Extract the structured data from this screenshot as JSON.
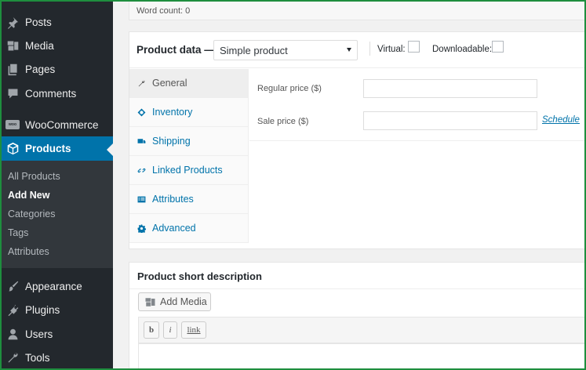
{
  "sidebar": {
    "menu": [
      {
        "label": "Posts",
        "icon": "pushpin-icon"
      },
      {
        "label": "Media",
        "icon": "media-icon"
      },
      {
        "label": "Pages",
        "icon": "pages-icon"
      },
      {
        "label": "Comments",
        "icon": "comment-icon"
      },
      {
        "label": "WooCommerce",
        "icon": "woocommerce-icon"
      },
      {
        "label": "Products",
        "icon": "products-cube-icon"
      },
      {
        "label": "Appearance",
        "icon": "paint-brush-icon"
      },
      {
        "label": "Plugins",
        "icon": "plugin-icon"
      },
      {
        "label": "Users",
        "icon": "user-icon"
      },
      {
        "label": "Tools",
        "icon": "wrench-icon"
      }
    ],
    "woo_badge": "woo",
    "submenu": [
      "All Products",
      "Add New",
      "Categories",
      "Tags",
      "Attributes"
    ],
    "active_submenu": "Add New",
    "accent_color": "#0073aa"
  },
  "editor": {
    "word_count": "Word count: 0"
  },
  "product_data": {
    "title": "Product data —",
    "type_selected": "Simple product",
    "virtual_label": "Virtual:",
    "virtual_checked": false,
    "downloadable_label": "Downloadable:",
    "downloadable_checked": false,
    "tabs": [
      {
        "label": "General",
        "icon": "wrench-icon",
        "active": true
      },
      {
        "label": "Inventory",
        "icon": "tag-icon",
        "active": false
      },
      {
        "label": "Shipping",
        "icon": "truck-icon",
        "active": false
      },
      {
        "label": "Linked Products",
        "icon": "link-icon",
        "active": false
      },
      {
        "label": "Attributes",
        "icon": "list-icon",
        "active": false
      },
      {
        "label": "Advanced",
        "icon": "gear-icon",
        "active": false
      }
    ],
    "regular_price_label": "Regular price ($)",
    "regular_price_value": "",
    "sale_price_label": "Sale price ($)",
    "sale_price_value": "",
    "schedule_link": "Schedule"
  },
  "short_description": {
    "title": "Product short description",
    "add_media_label": "Add Media",
    "toolbar": [
      "b",
      "i",
      "link"
    ],
    "content": ""
  }
}
